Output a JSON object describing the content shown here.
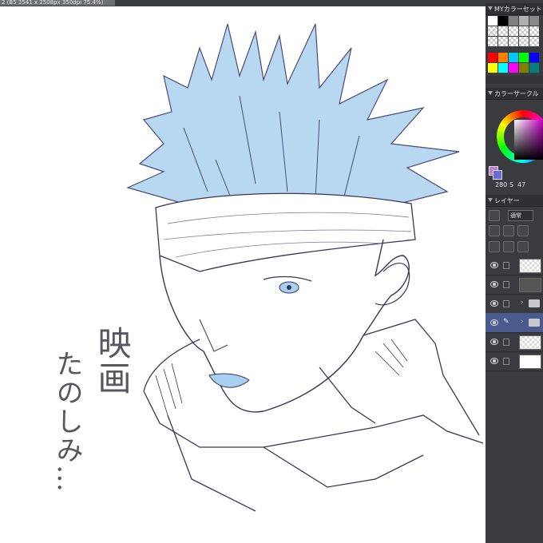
{
  "window": {
    "title_tab": "2 (B5 3541 x 2508px 350dpi 75.4%)"
  },
  "color_set_panel": {
    "title": "MYカラーセット",
    "swatch_colors": [
      "#ffffff",
      "#000000",
      "#7f7f7f",
      "#b0b0b0",
      "#ff0000",
      "#00a0ff",
      "#ff8000",
      "#ffff00",
      "#00ff00",
      "#0000ff",
      "#ff00ff",
      "#00ffff"
    ]
  },
  "color_circle_panel": {
    "title": "カラーサークル",
    "hue_value": "280",
    "s_label": "S",
    "s_value": "47",
    "main_color": "#c07cd6",
    "sub_color": "#6a6ad8"
  },
  "layer_panel": {
    "title": "レイヤー",
    "blend_mode": "通常",
    "layers": [
      {
        "kind": "raster",
        "thumb": "transparent"
      },
      {
        "kind": "raster",
        "thumb": "dark"
      },
      {
        "kind": "folder"
      },
      {
        "kind": "folder",
        "selected": true
      },
      {
        "kind": "raster",
        "thumb": "transparent"
      },
      {
        "kind": "paper",
        "thumb": "white"
      }
    ]
  },
  "canvas": {
    "handwritten_text_col1": "映画",
    "handwritten_text_col2": "たのしみ…",
    "hair_color": "#b8d8f2",
    "line_color": "#3a3558"
  }
}
